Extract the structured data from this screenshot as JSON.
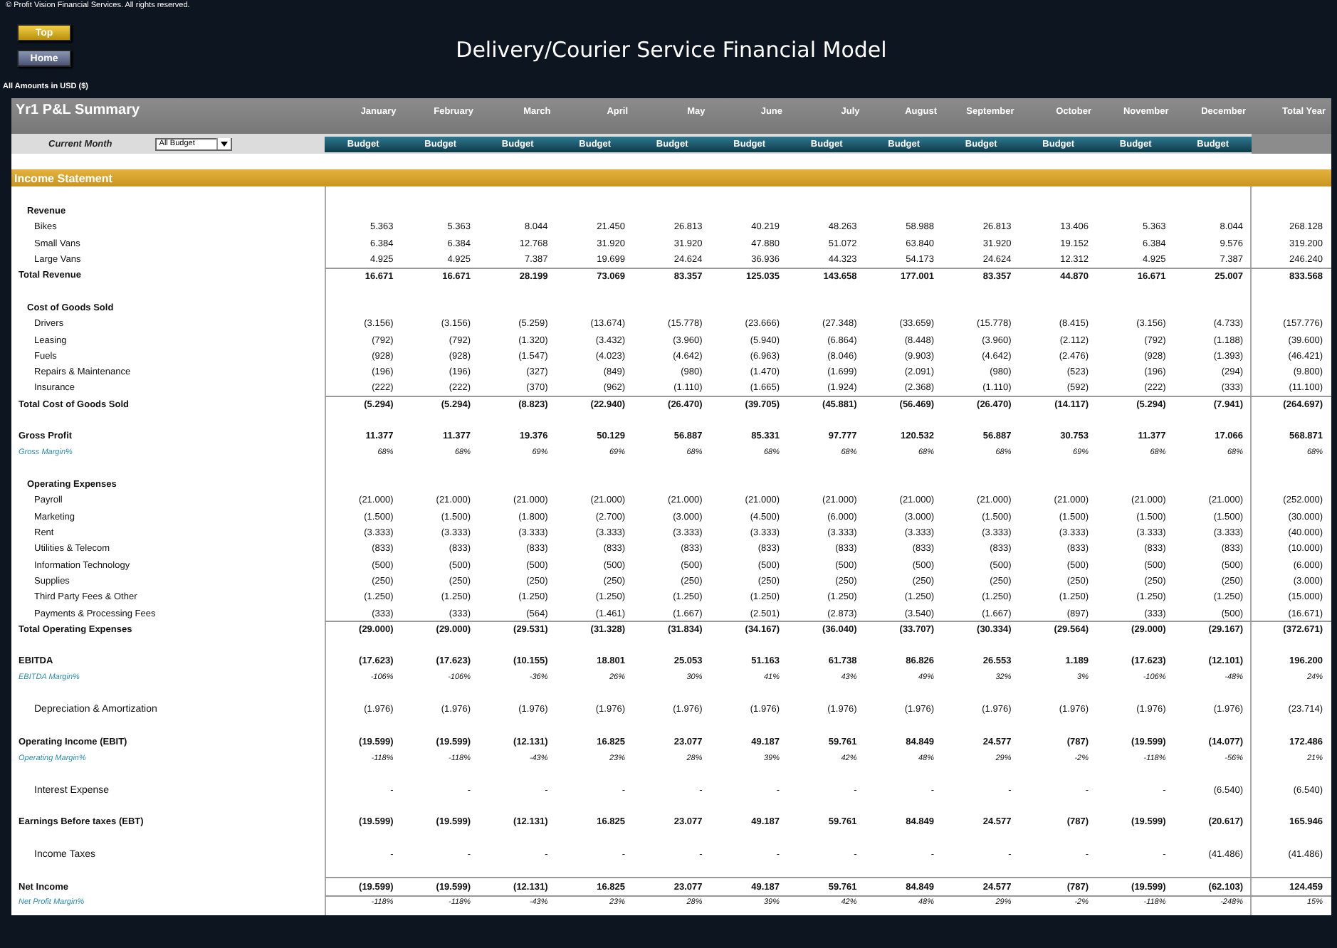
{
  "copyright": "© Profit Vision Financial Services. All rights reserved.",
  "nav_buttons": [
    {
      "label": "Top",
      "kind": "primary"
    },
    {
      "label": "Home",
      "kind": "secondary"
    }
  ],
  "title": "Delivery/Courier Service Financial Model",
  "currency_note": "All Amounts in USD ($)",
  "summary": {
    "title": "Yr1 P&L Summary",
    "columns": [
      "January",
      "February",
      "March",
      "April",
      "May",
      "June",
      "July",
      "August",
      "September",
      "October",
      "November",
      "December",
      "Total Year"
    ],
    "current_month_label": "Current Month",
    "scenario_select": "All Budget",
    "scenario_labels": [
      "Budget",
      "Budget",
      "Budget",
      "Budget",
      "Budget",
      "Budget",
      "Budget",
      "Budget",
      "Budget",
      "Budget",
      "Budget",
      "Budget"
    ]
  },
  "section_title": "Income Statement",
  "rows": [
    {
      "kind": "section",
      "label": "Revenue"
    },
    {
      "kind": "item",
      "label": "Bikes",
      "values": [
        "5.363",
        "5.363",
        "8.044",
        "21.450",
        "26.813",
        "40.219",
        "48.263",
        "58.988",
        "26.813",
        "13.406",
        "5.363",
        "8.044",
        "268.128"
      ]
    },
    {
      "kind": "item",
      "label": "Small Vans",
      "values": [
        "6.384",
        "6.384",
        "12.768",
        "31.920",
        "31.920",
        "47.880",
        "51.072",
        "63.840",
        "31.920",
        "19.152",
        "6.384",
        "9.576",
        "319.200"
      ]
    },
    {
      "kind": "item",
      "label": "Large Vans",
      "values": [
        "4.925",
        "4.925",
        "7.387",
        "19.699",
        "24.624",
        "36.936",
        "44.323",
        "54.173",
        "24.624",
        "12.312",
        "4.925",
        "7.387",
        "246.240"
      ]
    },
    {
      "kind": "total",
      "label": "Total Revenue",
      "values": [
        "16.671",
        "16.671",
        "28.199",
        "73.069",
        "83.357",
        "125.035",
        "143.658",
        "177.001",
        "83.357",
        "44.870",
        "16.671",
        "25.007",
        "833.568"
      ]
    },
    {
      "kind": "section",
      "label": "Cost of Goods Sold"
    },
    {
      "kind": "item",
      "label": "Drivers",
      "values": [
        "(3.156)",
        "(3.156)",
        "(5.259)",
        "(13.674)",
        "(15.778)",
        "(23.666)",
        "(27.348)",
        "(33.659)",
        "(15.778)",
        "(8.415)",
        "(3.156)",
        "(4.733)",
        "(157.776)"
      ]
    },
    {
      "kind": "item",
      "label": "Leasing",
      "values": [
        "(792)",
        "(792)",
        "(1.320)",
        "(3.432)",
        "(3.960)",
        "(5.940)",
        "(6.864)",
        "(8.448)",
        "(3.960)",
        "(2.112)",
        "(792)",
        "(1.188)",
        "(39.600)"
      ]
    },
    {
      "kind": "item",
      "label": "Fuels",
      "values": [
        "(928)",
        "(928)",
        "(1.547)",
        "(4.023)",
        "(4.642)",
        "(6.963)",
        "(8.046)",
        "(9.903)",
        "(4.642)",
        "(2.476)",
        "(928)",
        "(1.393)",
        "(46.421)"
      ]
    },
    {
      "kind": "item",
      "label": "Repairs & Maintenance",
      "values": [
        "(196)",
        "(196)",
        "(327)",
        "(849)",
        "(980)",
        "(1.470)",
        "(1.699)",
        "(2.091)",
        "(980)",
        "(523)",
        "(196)",
        "(294)",
        "(9.800)"
      ]
    },
    {
      "kind": "item",
      "label": "Insurance",
      "values": [
        "(222)",
        "(222)",
        "(370)",
        "(962)",
        "(1.110)",
        "(1.665)",
        "(1.924)",
        "(2.368)",
        "(1.110)",
        "(592)",
        "(222)",
        "(333)",
        "(11.100)"
      ]
    },
    {
      "kind": "total",
      "label": "Total Cost of Goods Sold",
      "values": [
        "(5.294)",
        "(5.294)",
        "(8.823)",
        "(22.940)",
        "(26.470)",
        "(39.705)",
        "(45.881)",
        "(56.469)",
        "(26.470)",
        "(14.117)",
        "(5.294)",
        "(7.941)",
        "(264.697)"
      ]
    },
    {
      "kind": "key",
      "label": "Gross Profit",
      "values": [
        "11.377",
        "11.377",
        "19.376",
        "50.129",
        "56.887",
        "85.331",
        "97.777",
        "120.532",
        "56.887",
        "30.753",
        "11.377",
        "17.066",
        "568.871"
      ]
    },
    {
      "kind": "margin",
      "label": "Gross Margin%",
      "values": [
        "68%",
        "68%",
        "69%",
        "69%",
        "68%",
        "68%",
        "68%",
        "68%",
        "68%",
        "69%",
        "68%",
        "68%",
        "68%"
      ]
    },
    {
      "kind": "section",
      "label": "Operating Expenses"
    },
    {
      "kind": "item",
      "label": "Payroll",
      "values": [
        "(21.000)",
        "(21.000)",
        "(21.000)",
        "(21.000)",
        "(21.000)",
        "(21.000)",
        "(21.000)",
        "(21.000)",
        "(21.000)",
        "(21.000)",
        "(21.000)",
        "(21.000)",
        "(252.000)"
      ]
    },
    {
      "kind": "item",
      "label": "Marketing",
      "values": [
        "(1.500)",
        "(1.500)",
        "(1.800)",
        "(2.700)",
        "(3.000)",
        "(4.500)",
        "(6.000)",
        "(3.000)",
        "(1.500)",
        "(1.500)",
        "(1.500)",
        "(1.500)",
        "(30.000)"
      ]
    },
    {
      "kind": "item",
      "label": "Rent",
      "values": [
        "(3.333)",
        "(3.333)",
        "(3.333)",
        "(3.333)",
        "(3.333)",
        "(3.333)",
        "(3.333)",
        "(3.333)",
        "(3.333)",
        "(3.333)",
        "(3.333)",
        "(3.333)",
        "(40.000)"
      ]
    },
    {
      "kind": "item",
      "label": "Utilities & Telecom",
      "values": [
        "(833)",
        "(833)",
        "(833)",
        "(833)",
        "(833)",
        "(833)",
        "(833)",
        "(833)",
        "(833)",
        "(833)",
        "(833)",
        "(833)",
        "(10.000)"
      ]
    },
    {
      "kind": "item",
      "label": "Information Technology",
      "values": [
        "(500)",
        "(500)",
        "(500)",
        "(500)",
        "(500)",
        "(500)",
        "(500)",
        "(500)",
        "(500)",
        "(500)",
        "(500)",
        "(500)",
        "(6.000)"
      ]
    },
    {
      "kind": "item",
      "label": "Supplies",
      "values": [
        "(250)",
        "(250)",
        "(250)",
        "(250)",
        "(250)",
        "(250)",
        "(250)",
        "(250)",
        "(250)",
        "(250)",
        "(250)",
        "(250)",
        "(3.000)"
      ]
    },
    {
      "kind": "item",
      "label": "Third Party Fees & Other",
      "values": [
        "(1.250)",
        "(1.250)",
        "(1.250)",
        "(1.250)",
        "(1.250)",
        "(1.250)",
        "(1.250)",
        "(1.250)",
        "(1.250)",
        "(1.250)",
        "(1.250)",
        "(1.250)",
        "(15.000)"
      ]
    },
    {
      "kind": "item",
      "label": "Payments & Processing Fees",
      "values": [
        "(333)",
        "(333)",
        "(564)",
        "(1.461)",
        "(1.667)",
        "(2.501)",
        "(2.873)",
        "(3.540)",
        "(1.667)",
        "(897)",
        "(333)",
        "(500)",
        "(16.671)"
      ]
    },
    {
      "kind": "total",
      "label": "Total Operating Expenses",
      "values": [
        "(29.000)",
        "(29.000)",
        "(29.531)",
        "(31.328)",
        "(31.834)",
        "(34.167)",
        "(36.040)",
        "(33.707)",
        "(30.334)",
        "(29.564)",
        "(29.000)",
        "(29.167)",
        "(372.671)"
      ]
    },
    {
      "kind": "key",
      "label": "EBITDA",
      "values": [
        "(17.623)",
        "(17.623)",
        "(10.155)",
        "18.801",
        "25.053",
        "51.163",
        "61.738",
        "86.826",
        "26.553",
        "1.189",
        "(17.623)",
        "(12.101)",
        "196.200"
      ]
    },
    {
      "kind": "margin",
      "label": "EBITDA Margin%",
      "values": [
        "-106%",
        "-106%",
        "-36%",
        "26%",
        "30%",
        "41%",
        "43%",
        "49%",
        "32%",
        "3%",
        "-106%",
        "-48%",
        "24%"
      ]
    },
    {
      "kind": "single",
      "label": "Depreciation & Amortization",
      "values": [
        "(1.976)",
        "(1.976)",
        "(1.976)",
        "(1.976)",
        "(1.976)",
        "(1.976)",
        "(1.976)",
        "(1.976)",
        "(1.976)",
        "(1.976)",
        "(1.976)",
        "(1.976)",
        "(23.714)"
      ]
    },
    {
      "kind": "key",
      "label": "Operating Income (EBIT)",
      "values": [
        "(19.599)",
        "(19.599)",
        "(12.131)",
        "16.825",
        "23.077",
        "49.187",
        "59.761",
        "84.849",
        "24.577",
        "(787)",
        "(19.599)",
        "(14.077)",
        "172.486"
      ]
    },
    {
      "kind": "margin",
      "label": "Operating Margin%",
      "values": [
        "-118%",
        "-118%",
        "-43%",
        "23%",
        "28%",
        "39%",
        "42%",
        "48%",
        "29%",
        "-2%",
        "-118%",
        "-56%",
        "21%"
      ]
    },
    {
      "kind": "single",
      "label": "Interest Expense",
      "values": [
        "-",
        "-",
        "-",
        "-",
        "-",
        "-",
        "-",
        "-",
        "-",
        "-",
        "-",
        "(6.540)",
        "(6.540)"
      ]
    },
    {
      "kind": "key",
      "label": "Earnings Before taxes (EBT)",
      "values": [
        "(19.599)",
        "(19.599)",
        "(12.131)",
        "16.825",
        "23.077",
        "49.187",
        "59.761",
        "84.849",
        "24.577",
        "(787)",
        "(19.599)",
        "(20.617)",
        "165.946"
      ]
    },
    {
      "kind": "single",
      "label": "Income Taxes",
      "values": [
        "-",
        "-",
        "-",
        "-",
        "-",
        "-",
        "-",
        "-",
        "-",
        "-",
        "-",
        "(41.486)",
        "(41.486)"
      ]
    },
    {
      "kind": "net",
      "label": "Net Income",
      "values": [
        "(19.599)",
        "(19.599)",
        "(12.131)",
        "16.825",
        "23.077",
        "49.187",
        "59.761",
        "84.849",
        "24.577",
        "(787)",
        "(19.599)",
        "(62.103)",
        "124.459"
      ]
    },
    {
      "kind": "margin",
      "label": "Net Profit Margin%",
      "values": [
        "-118%",
        "-118%",
        "-43%",
        "23%",
        "28%",
        "39%",
        "42%",
        "48%",
        "29%",
        "-2%",
        "-118%",
        "-248%",
        "15%"
      ]
    }
  ]
}
